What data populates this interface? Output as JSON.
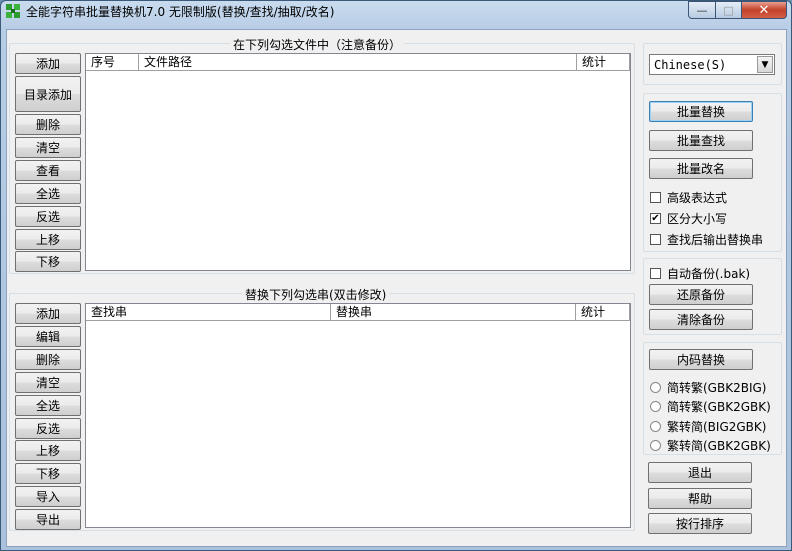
{
  "window": {
    "title": "全能字符串批量替换机7.0 无限制版(替换/查找/抽取/改名)",
    "controls": {
      "minimize": "—",
      "maximize": "□",
      "close": "✕"
    }
  },
  "files_group": {
    "title": "在下列勾选文件中（注意备份）",
    "buttons": [
      "添加",
      "目录添加",
      "删除",
      "清空",
      "查看",
      "全选",
      "反选",
      "上移",
      "下移"
    ],
    "columns": [
      "序号",
      "文件路径",
      "统计"
    ]
  },
  "replace_group": {
    "title": "替换下列勾选串(双击修改)",
    "buttons": [
      "添加",
      "编辑",
      "删除",
      "清空",
      "全选",
      "反选",
      "上移",
      "下移",
      "导入",
      "导出"
    ],
    "columns": [
      "查找串",
      "替换串",
      "统计"
    ]
  },
  "language": {
    "selected": "Chinese(S)"
  },
  "actions": {
    "batch_replace": "批量替换",
    "batch_find": "批量查找",
    "batch_rename": "批量改名",
    "regex": "高级表达式",
    "case_sensitive": "区分大小写",
    "output_after_find": "查找后输出替换串"
  },
  "backup": {
    "auto_backup": "自动备份(.bak)",
    "restore": "还原备份",
    "clear": "清除备份"
  },
  "encoding": {
    "button": "内码替换",
    "options": [
      "简转繁(GBK2BIG)",
      "简转繁(GBK2GBK)",
      "繁转简(BIG2GBK)",
      "繁转简(GBK2GBK)"
    ]
  },
  "bottom": {
    "exit": "退出",
    "help": "帮助",
    "sort": "按行排序"
  },
  "checkmark": "✔",
  "colors": {
    "title_bar": "#b7cde6",
    "close": "#c4412b",
    "face": "#f0f0f0"
  }
}
